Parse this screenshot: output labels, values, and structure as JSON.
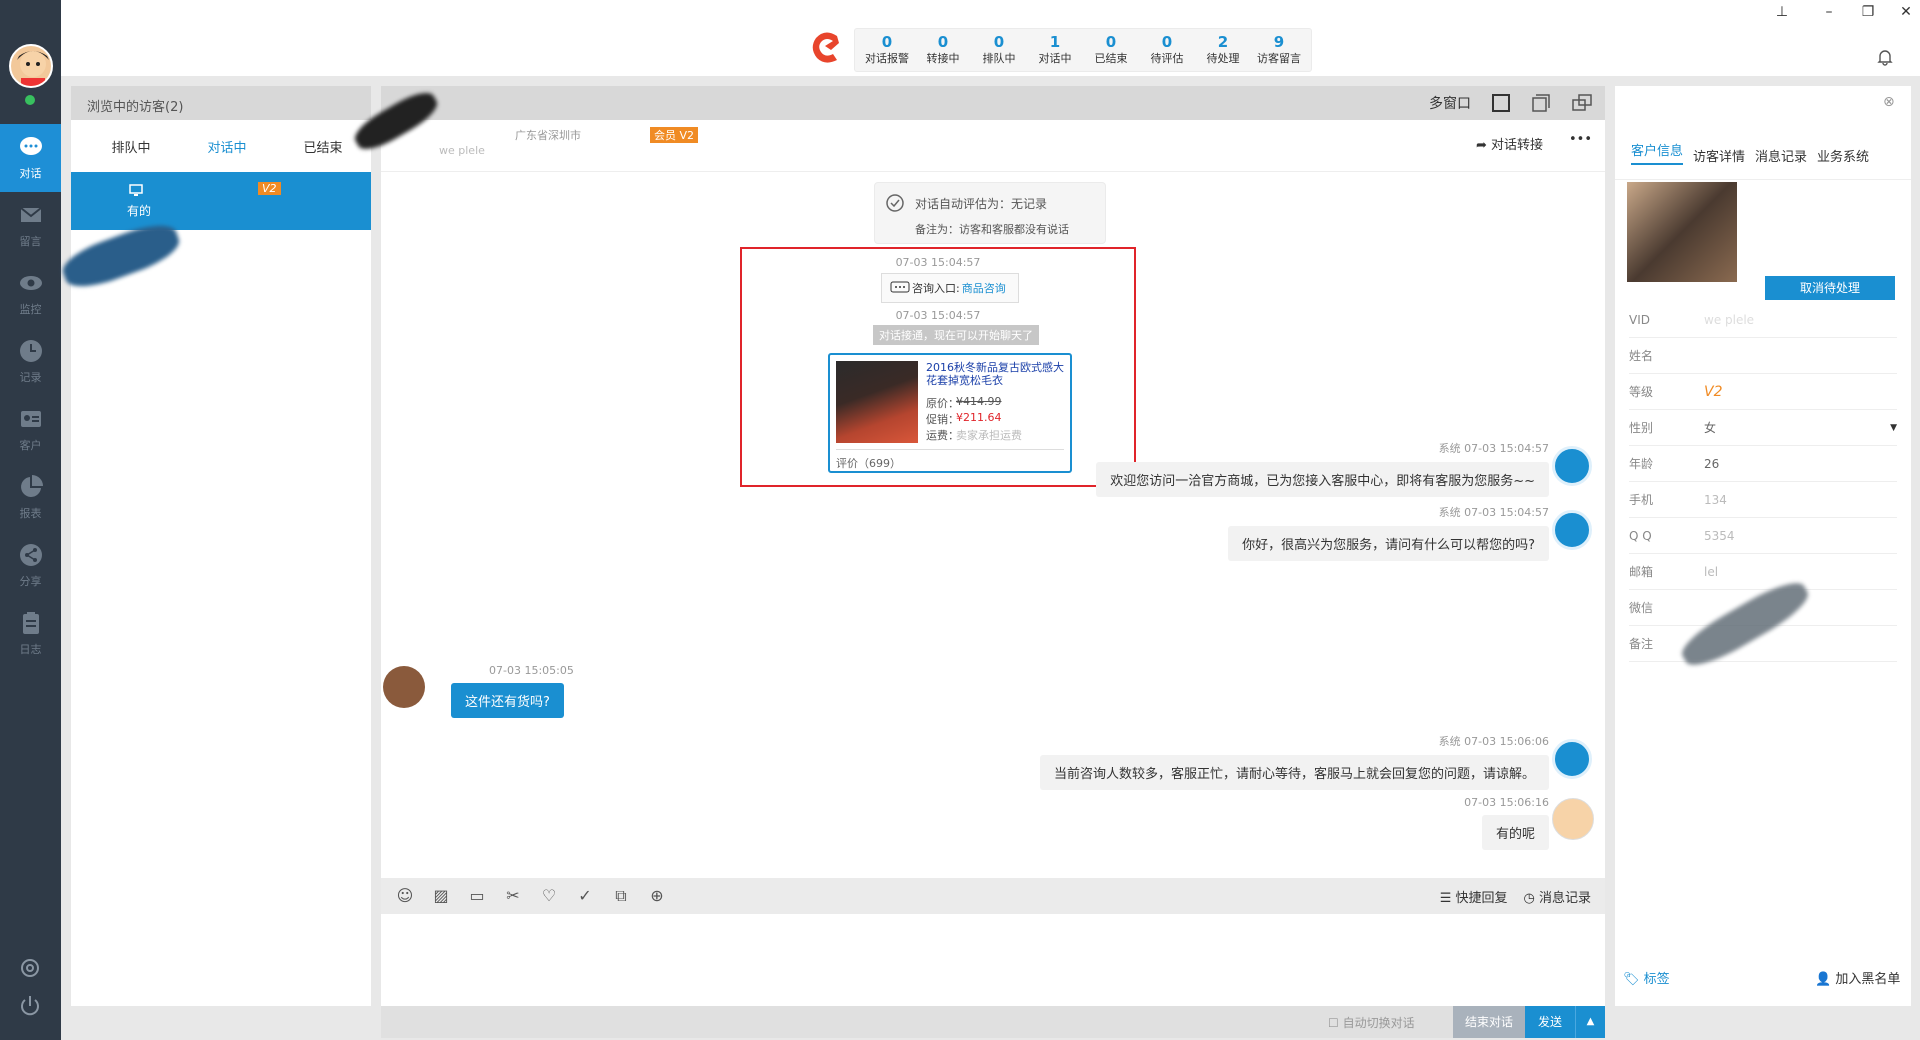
{
  "nav": {
    "items": [
      {
        "label": "对话",
        "icon": "chat-icon"
      },
      {
        "label": "留言",
        "icon": "mail-icon"
      },
      {
        "label": "监控",
        "icon": "eye-icon"
      },
      {
        "label": "记录",
        "icon": "clock-icon"
      },
      {
        "label": "客户",
        "icon": "contact-card-icon"
      },
      {
        "label": "报表",
        "icon": "pie-chart-icon"
      },
      {
        "label": "分享",
        "icon": "share-icon"
      },
      {
        "label": "日志",
        "icon": "clipboard-icon"
      }
    ]
  },
  "stats": [
    {
      "value": "0",
      "label": "对话报警"
    },
    {
      "value": "0",
      "label": "转接中"
    },
    {
      "value": "0",
      "label": "排队中"
    },
    {
      "value": "1",
      "label": "对话中"
    },
    {
      "value": "0",
      "label": "已结束"
    },
    {
      "value": "0",
      "label": "待评估"
    },
    {
      "value": "2",
      "label": "待处理"
    },
    {
      "value": "9",
      "label": "访客留言"
    }
  ],
  "left": {
    "header": "浏览中的访客(2)",
    "tabs": [
      "排队中",
      "对话中",
      "已结束"
    ],
    "active_tab": 1,
    "visitor": {
      "badge": "V2",
      "name": "有的"
    }
  },
  "chat": {
    "toolbar": {
      "multi_window": "多窗口"
    },
    "head": {
      "location": "广东省深圳市",
      "member_badge": "会员 V2",
      "sub": "we   plele",
      "transfer": "对话转接",
      "more": "•••"
    },
    "eval": {
      "line1": "对话自动评估为：无记录",
      "line2": "备注为：访客和客服都没有说话"
    },
    "t1": "07-03 15:04:57",
    "entry_label": "咨询入口:",
    "entry_value": "商品咨询",
    "t2": "07-03 15:04:57",
    "connected": "对话接通，现在可以开始聊天了",
    "product": {
      "title": "2016秋冬新品复古欧式感大花套掉宽松毛衣",
      "orig_label": "原价：",
      "orig_price": "¥414.99",
      "sale_label": "促销：",
      "sale_price": "¥211.64",
      "ship_label": "运费：",
      "ship_value": "卖家承担运费",
      "reviews": "评价（699）"
    },
    "messages": [
      {
        "meta": "系统  07-03 15:04:57",
        "text": "欢迎您访问一洽官方商城，已为您接入客服中心，即将有客服为您服务~~"
      },
      {
        "meta": "系统  07-03 15:04:57",
        "text": "你好，很高兴为您服务，请问有什么可以帮您的吗?"
      },
      {
        "meta": "07-03 15:05:05",
        "text": "这件还有货吗?"
      },
      {
        "meta": "系统  07-03 15:06:06",
        "text": "当前咨询人数较多，客服正忙，请耐心等待，客服马上就会回复您的问题，请谅解。"
      },
      {
        "meta": "07-03 15:06:16",
        "text": "有的呢"
      }
    ],
    "quick_reply": "快捷回复",
    "history": "消息记录",
    "auto_switch": "自动切换对话",
    "end": "结束对话",
    "send": "发送"
  },
  "right": {
    "tabs": [
      "客户信息",
      "访客详情",
      "消息记录",
      "业务系统"
    ],
    "cancel_btn": "取消待处理",
    "fields": [
      {
        "k": "VID",
        "v": "we   plele"
      },
      {
        "k": "姓名",
        "v": ""
      },
      {
        "k": "等级",
        "v": "V2"
      },
      {
        "k": "性别",
        "v": "女"
      },
      {
        "k": "年龄",
        "v": "26"
      },
      {
        "k": "手机",
        "v": "134"
      },
      {
        "k": "Q Q",
        "v": "5354"
      },
      {
        "k": "邮箱",
        "v": "lel"
      },
      {
        "k": "微信",
        "v": ""
      },
      {
        "k": "备注",
        "v": ""
      }
    ],
    "tag": "标签",
    "blacklist": "加入黑名单"
  }
}
